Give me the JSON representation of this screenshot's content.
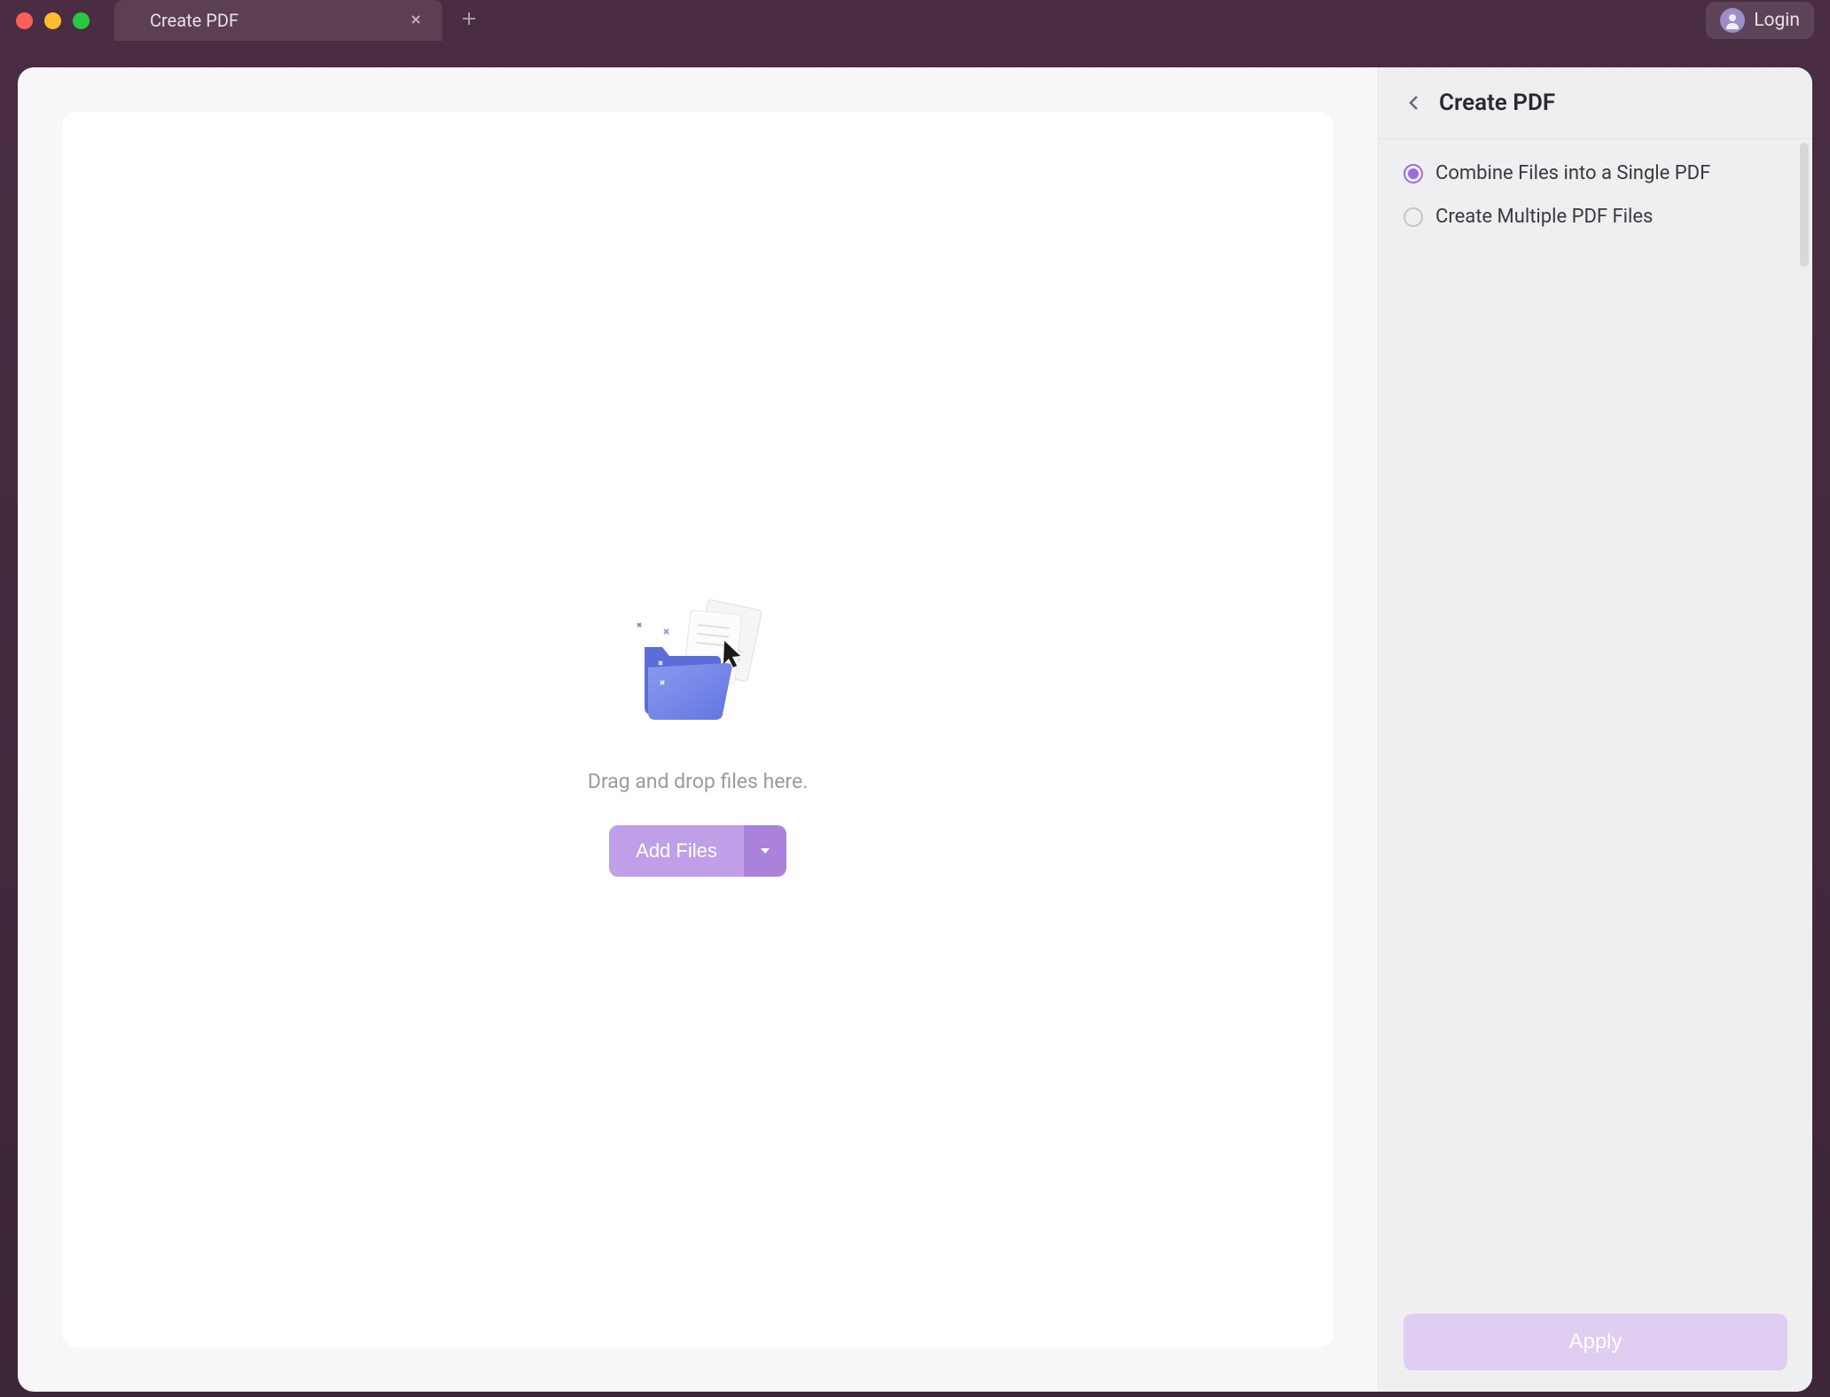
{
  "titlebar": {
    "tab_label": "Create PDF",
    "login_label": "Login"
  },
  "main": {
    "drop_text": "Drag and drop files here.",
    "add_files_label": "Add Files"
  },
  "sidebar": {
    "title": "Create PDF",
    "options": [
      {
        "label": "Combine Files into a Single PDF",
        "selected": true
      },
      {
        "label": "Create Multiple PDF Files",
        "selected": false
      }
    ],
    "apply_label": "Apply"
  },
  "colors": {
    "accent": "#9b6dd7",
    "button_light": "#c09fe8",
    "button_dark": "#ab82db",
    "apply_bg": "#e0cdf2"
  }
}
